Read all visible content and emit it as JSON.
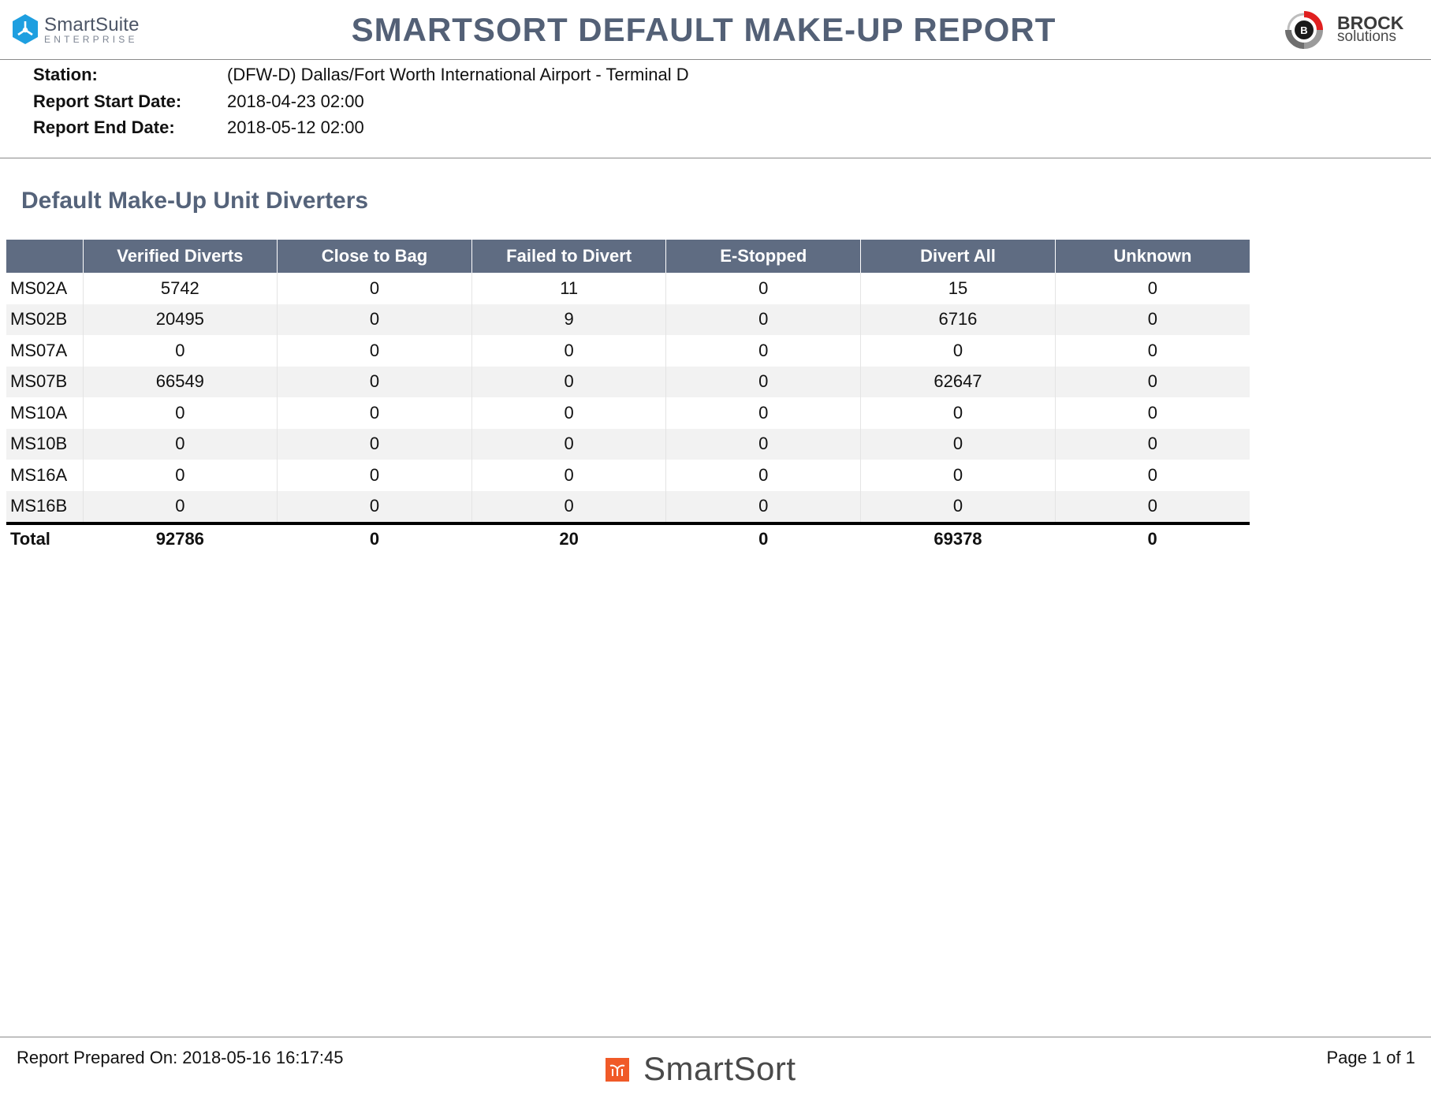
{
  "header": {
    "left_logo_name": "SmartSuite",
    "left_logo_sub": "ENTERPRISE",
    "title": "SMARTSORT DEFAULT MAKE-UP REPORT",
    "right_logo_letter": "B",
    "right_logo_name": "BROCK",
    "right_logo_sub": "solutions"
  },
  "info": {
    "station_label": "Station:",
    "station_value": "(DFW-D) Dallas/Fort Worth International Airport - Terminal D",
    "start_label": "Report Start Date:",
    "start_value": "2018-04-23 02:00",
    "end_label": "Report End Date:",
    "end_value": "2018-05-12 02:00"
  },
  "section_title": "Default Make-Up Unit Diverters",
  "table": {
    "columns": [
      "",
      "Verified Diverts",
      "Close to Bag",
      "Failed to Divert",
      "E-Stopped",
      "Divert All",
      "Unknown"
    ],
    "rows": [
      [
        "MS02A",
        "5742",
        "0",
        "11",
        "0",
        "15",
        "0"
      ],
      [
        "MS02B",
        "20495",
        "0",
        "9",
        "0",
        "6716",
        "0"
      ],
      [
        "MS07A",
        "0",
        "0",
        "0",
        "0",
        "0",
        "0"
      ],
      [
        "MS07B",
        "66549",
        "0",
        "0",
        "0",
        "62647",
        "0"
      ],
      [
        "MS10A",
        "0",
        "0",
        "0",
        "0",
        "0",
        "0"
      ],
      [
        "MS10B",
        "0",
        "0",
        "0",
        "0",
        "0",
        "0"
      ],
      [
        "MS16A",
        "0",
        "0",
        "0",
        "0",
        "0",
        "0"
      ],
      [
        "MS16B",
        "0",
        "0",
        "0",
        "0",
        "0",
        "0"
      ]
    ],
    "total": [
      "Total",
      "92786",
      "0",
      "20",
      "0",
      "69378",
      "0"
    ]
  },
  "footer": {
    "prepared_label": "Report Prepared On:",
    "prepared_value": "2018-05-16 16:17:45",
    "brand": "SmartSort",
    "page": "Page 1 of 1"
  },
  "colors": {
    "header_fill": "#5f6c82",
    "title_color": "#536076",
    "stripe": "#f2f2f2",
    "smartsort_orange": "#f05a28",
    "brock_red": "#e02020"
  }
}
